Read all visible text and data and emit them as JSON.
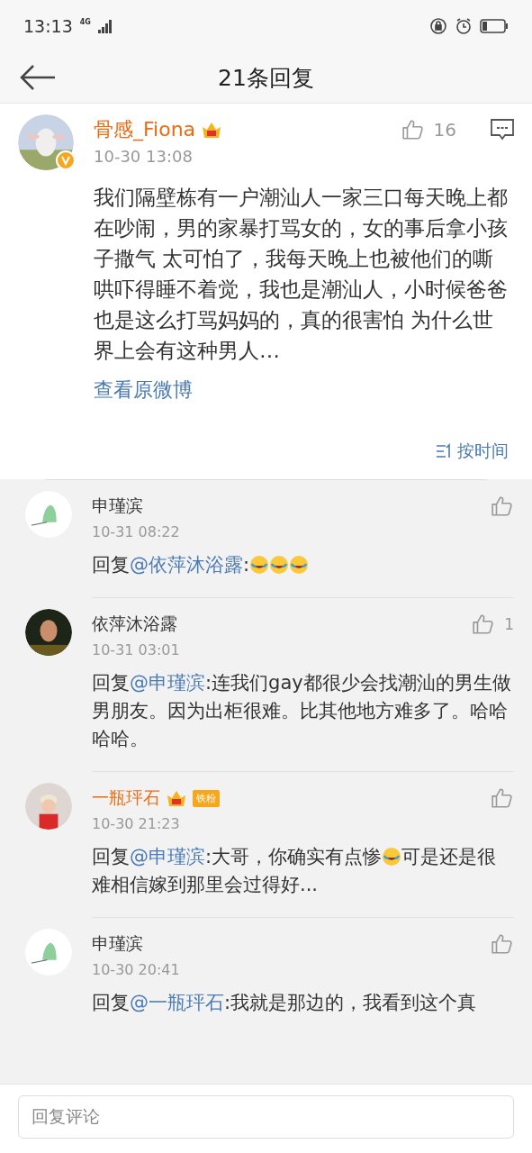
{
  "status_bar": {
    "time": "13:13",
    "network": "4G"
  },
  "header": {
    "title": "21条回复"
  },
  "post": {
    "author": "骨感_Fiona",
    "vip": true,
    "verified": true,
    "time": "10-30 13:08",
    "likes": "16",
    "text": "我们隔壁栋有一户潮汕人一家三口每天晚上都在吵闹，男的家暴打骂女的，女的事后拿小孩子撒气  太可怕了，我每天晚上也被他们的嘶哄吓得睡不着觉，我也是潮汕人，小时候爸爸也是这么打骂妈妈的，真的很害怕  为什么世界上会有这种男人…",
    "link": "查看原微博",
    "sort": "按时间"
  },
  "comments": [
    {
      "author": "申瑾滨",
      "vip": false,
      "time": "10-31 08:22",
      "body": [
        {
          "kind": "text",
          "text": "回复"
        },
        {
          "kind": "mention",
          "text": "@依萍沐浴露"
        },
        {
          "kind": "text",
          "text": ":"
        },
        {
          "kind": "emoji"
        },
        {
          "kind": "emoji"
        },
        {
          "kind": "emoji"
        }
      ]
    },
    {
      "author": "依萍沐浴露",
      "vip": false,
      "time": "10-31 03:01",
      "likes": "1",
      "body": [
        {
          "kind": "text",
          "text": "回复"
        },
        {
          "kind": "mention",
          "text": "@申瑾滨"
        },
        {
          "kind": "text",
          "text": ":连我们gay都很少会找潮汕的男生做男朋友。因为出柜很难。比其他地方难多了。哈哈哈哈。"
        }
      ]
    },
    {
      "author": "一瓶玶石",
      "vip": true,
      "fan_badge": "铁粉",
      "time": "10-30 21:23",
      "body": [
        {
          "kind": "text",
          "text": "回复"
        },
        {
          "kind": "mention",
          "text": "@申瑾滨"
        },
        {
          "kind": "text",
          "text": ":大哥，你确实有点惨"
        },
        {
          "kind": "emoji"
        },
        {
          "kind": "text",
          "text": "可是还是很难相信嫁到那里会过得好..."
        }
      ]
    },
    {
      "author": "申瑾滨",
      "vip": false,
      "time": "10-30 20:41",
      "body": [
        {
          "kind": "text",
          "text": "回复"
        },
        {
          "kind": "mention",
          "text": "@一瓶玶石"
        },
        {
          "kind": "text",
          "text": ":我就是那边的，我看到这个真"
        }
      ]
    }
  ],
  "reply_field": {
    "placeholder": "回复评论"
  }
}
